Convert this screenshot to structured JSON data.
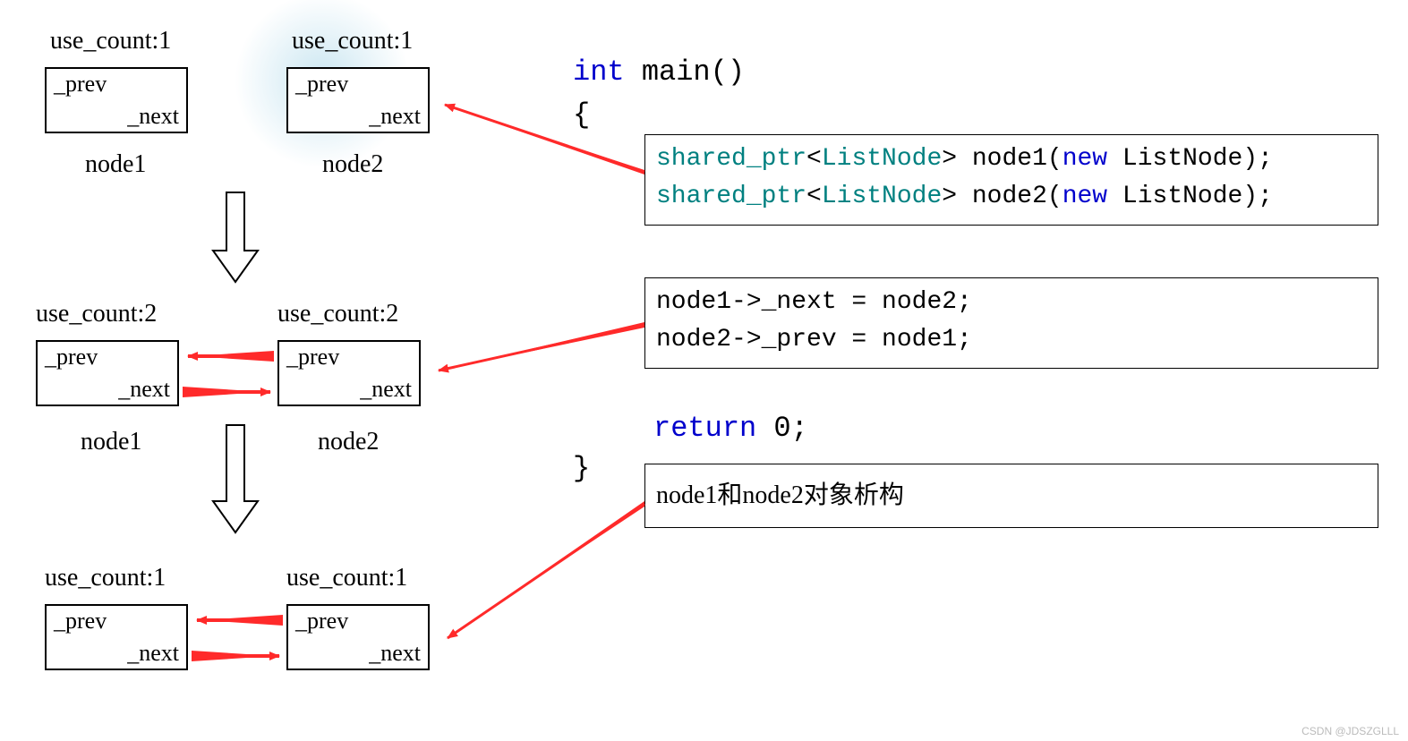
{
  "row1": {
    "node1": {
      "use_count": "use_count:1",
      "prev": "_prev",
      "next": "_next",
      "name": "node1"
    },
    "node2": {
      "use_count": "use_count:1",
      "prev": "_prev",
      "next": "_next",
      "name": "node2"
    }
  },
  "row2": {
    "node1": {
      "use_count": "use_count:2",
      "prev": "_prev",
      "next": "_next",
      "name": "node1"
    },
    "node2": {
      "use_count": "use_count:2",
      "prev": "_prev",
      "next": "_next",
      "name": "node2"
    }
  },
  "row3": {
    "node1": {
      "use_count": "use_count:1",
      "prev": "_prev",
      "next": "_next"
    },
    "node2": {
      "use_count": "use_count:1",
      "prev": "_prev",
      "next": "_next"
    }
  },
  "code": {
    "sig_int": "int",
    "sig_main": " main()",
    "brace_open": "{",
    "brace_close": "}",
    "box1_line1": {
      "t1": "shared_ptr",
      "t2": "<",
      "t3": "ListNode",
      "t4": "> node1(",
      "t5": "new",
      "t6": " ListNode);"
    },
    "box1_line2": {
      "t1": "shared_ptr",
      "t2": "<",
      "t3": "ListNode",
      "t4": "> node2(",
      "t5": "new",
      "t6": " ListNode);"
    },
    "box2_line1": "node1->_next = node2;",
    "box2_line2": "node2->_prev = node1;",
    "ret_kw": "return",
    "ret_rest": " 0;",
    "box3": "node1和node2对象析构"
  },
  "watermark": "CSDN @JDSZGLLL"
}
